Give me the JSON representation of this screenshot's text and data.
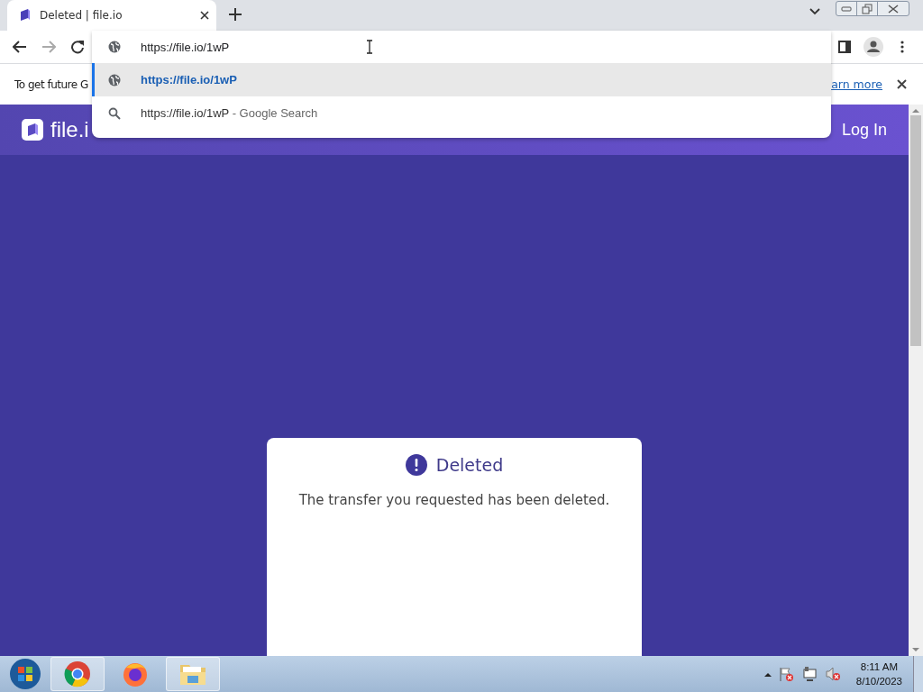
{
  "browser": {
    "tab": {
      "title": "Deleted | file.io",
      "selected": true
    },
    "address": {
      "value": "https://file.io/1wP"
    },
    "suggestions": [
      {
        "kind": "url",
        "text": "https://file.io/1wP",
        "selected": true
      },
      {
        "kind": "search",
        "text": "https://file.io/1wP",
        "suffix": "- Google Search",
        "selected": false
      }
    ],
    "infobar": {
      "text": "To get future G",
      "link": "arn more"
    }
  },
  "page": {
    "logo": "file.i",
    "login": "Log In",
    "card": {
      "title": "Deleted",
      "message": "The transfer you requested has been deleted."
    }
  },
  "taskbar": {
    "time": "8:11 AM",
    "date": "8/10/2023"
  }
}
